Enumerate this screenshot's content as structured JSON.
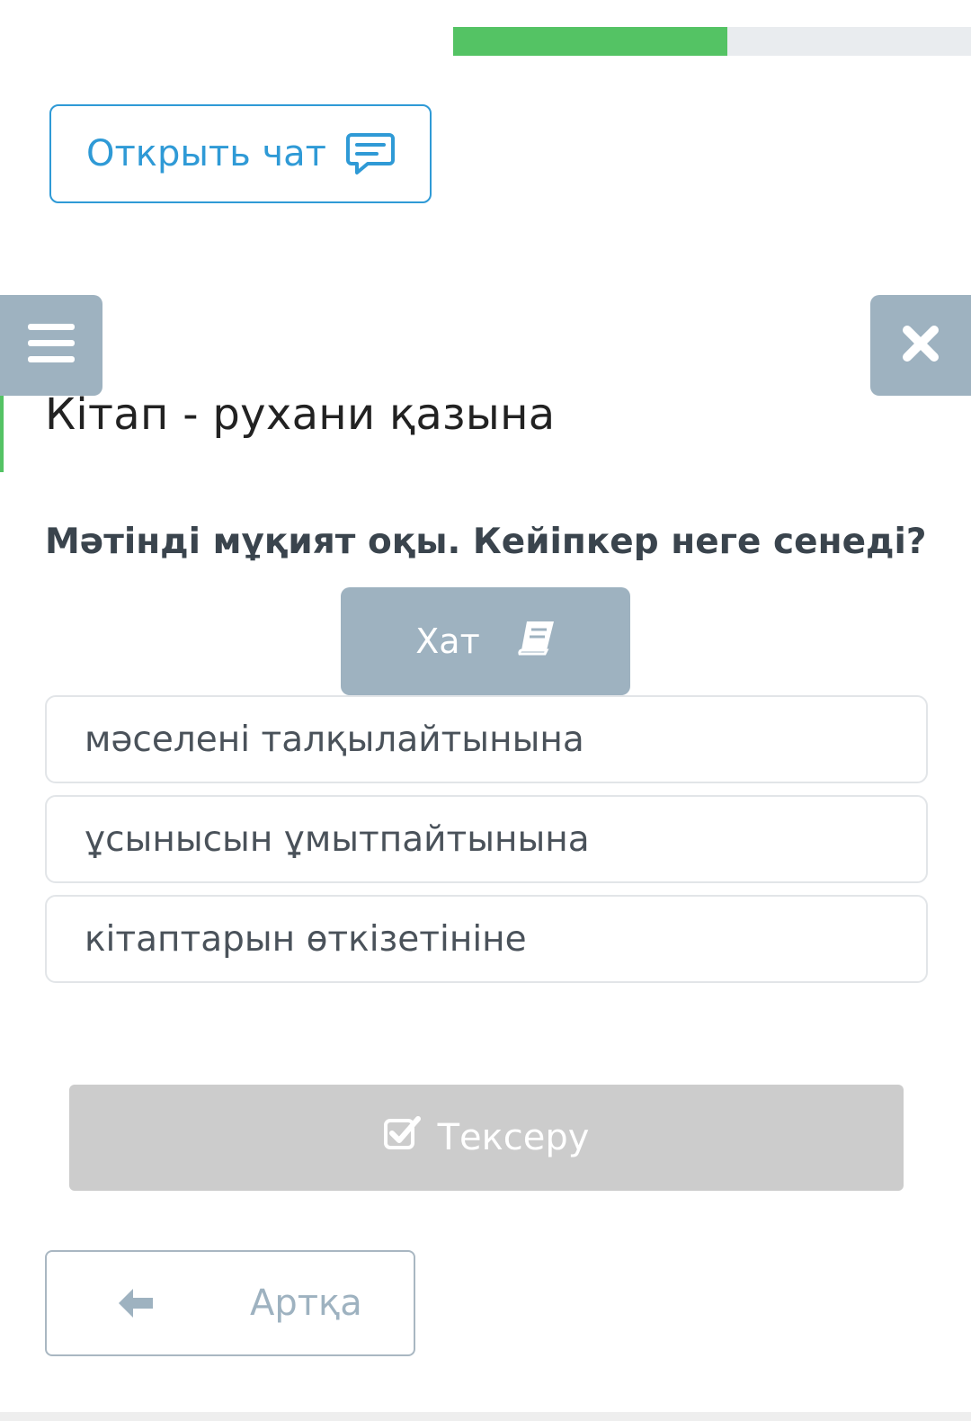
{
  "progress": {
    "fraction": 0.53,
    "color": "#54c364"
  },
  "chat_button": {
    "label": "Открыть чат",
    "icon": "chat-bubble-icon"
  },
  "nav": {
    "menu_icon": "hamburger-menu-icon",
    "close_icon": "close-icon"
  },
  "lesson": {
    "title": "Кітап - рухани қазына"
  },
  "question": {
    "text": "Мәтінді мұқият оқы. Кейіпкер неге сенеді?",
    "text_button_label": "Хат",
    "text_button_icon": "book-icon"
  },
  "answers": [
    {
      "label": "мәселені талқылайтынына"
    },
    {
      "label": "ұсынысын ұмытпайтынына"
    },
    {
      "label": "кітаптарын өткізетініне"
    }
  ],
  "check_button": {
    "label": "Тексеру",
    "icon": "checkbox-icon"
  },
  "back_button": {
    "label": "Артқа",
    "icon": "arrow-left-icon"
  },
  "colors": {
    "accent_blue": "#2f9ad6",
    "slate": "#9eb2c0",
    "disabled": "#cccccc"
  }
}
